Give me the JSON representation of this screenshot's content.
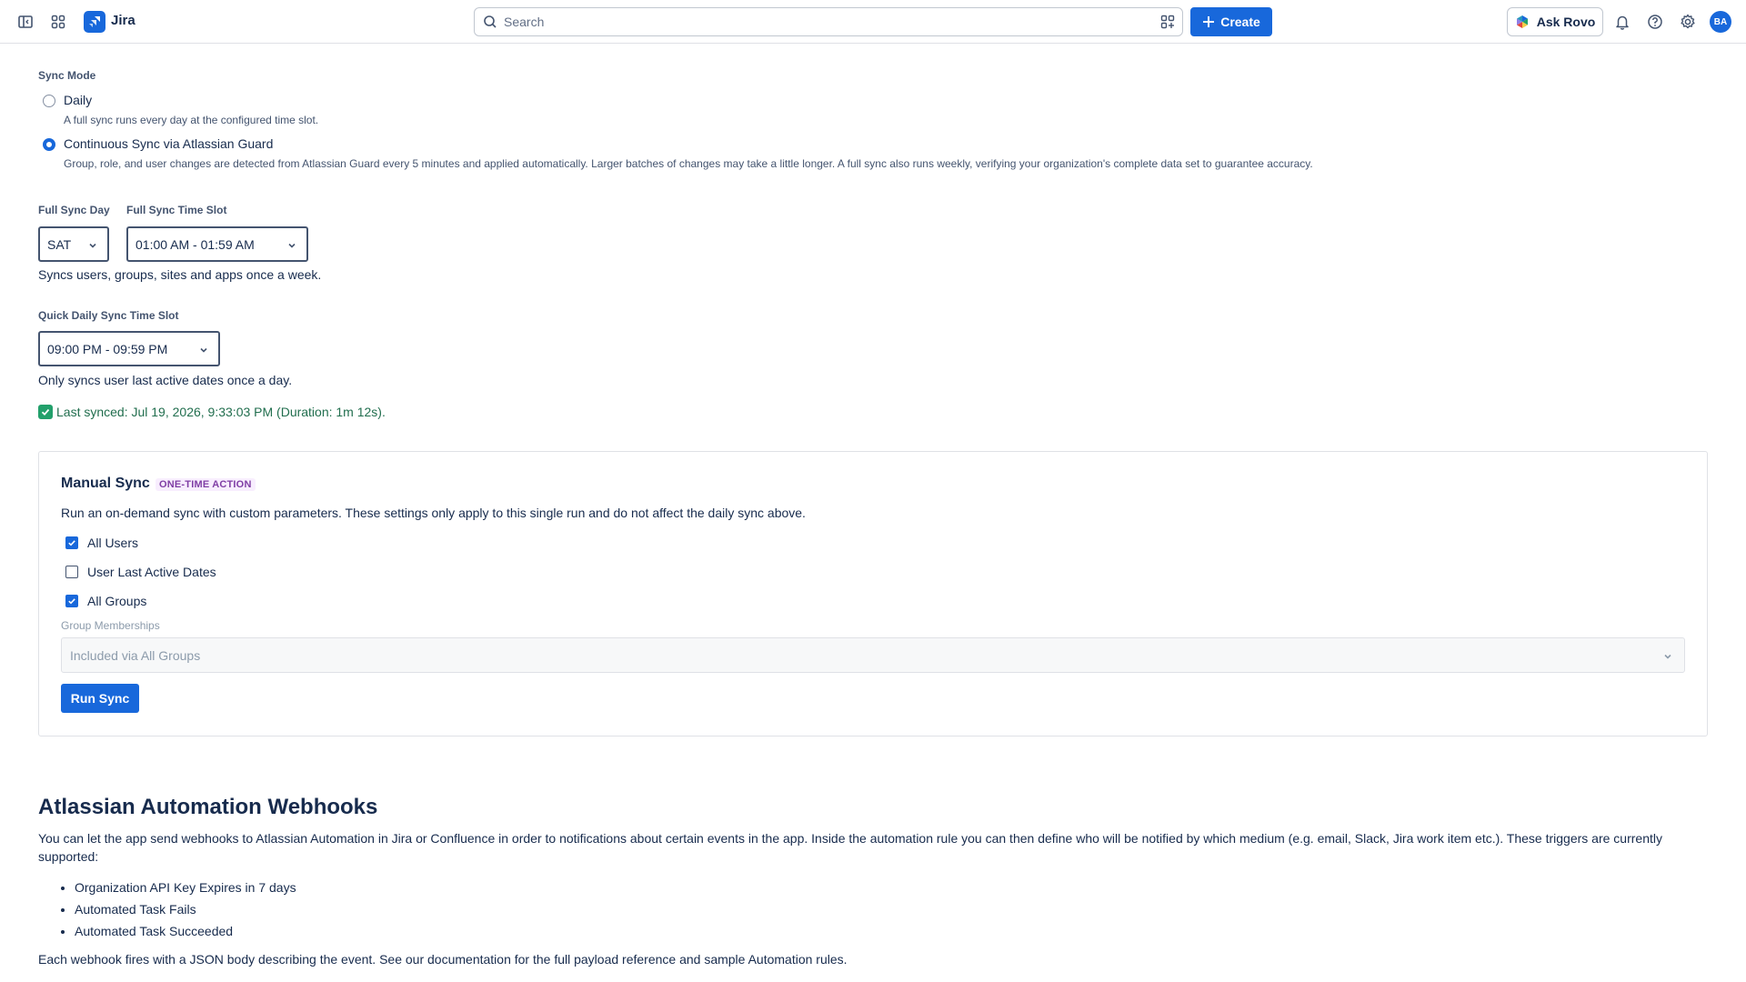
{
  "topbar": {
    "app_name": "Jira",
    "search_placeholder": "Search",
    "create_label": "Create",
    "rovo_label": "Ask Rovo",
    "avatar_initials": "BA",
    "brand_color": "#1868db"
  },
  "sync_mode": {
    "label": "Sync Mode",
    "options": [
      {
        "label": "Daily",
        "description": "A full sync runs every day at the configured time slot.",
        "selected": false
      },
      {
        "label": "Continuous Sync via Atlassian Guard",
        "description": "Group, role, and user changes are detected from Atlassian Guard every 5 minutes and applied automatically. Larger batches of changes may take a little longer. A full sync also runs weekly, verifying your organization's complete data set to guarantee accuracy.",
        "selected": true
      }
    ]
  },
  "full_sync": {
    "day_label": "Full Sync Day",
    "day_value": "SAT",
    "slot_label": "Full Sync Time Slot",
    "slot_value": "01:00 AM - 01:59 AM",
    "helper": "Syncs users, groups, sites and apps once a week."
  },
  "quick_sync": {
    "label": "Quick Daily Sync Time Slot",
    "value": "09:00 PM - 09:59 PM",
    "helper": "Only syncs user last active dates once a day."
  },
  "last_synced": "Last synced: Jul 19, 2026, 9:33:03 PM (Duration: 1m 12s).",
  "manual_sync": {
    "title": "Manual Sync",
    "badge": "ONE-TIME ACTION",
    "description": "Run an on-demand sync with custom parameters. These settings only apply to this single run and do not affect the daily sync above.",
    "options": [
      {
        "label": "All Users",
        "checked": true
      },
      {
        "label": "User Last Active Dates",
        "checked": false
      },
      {
        "label": "All Groups",
        "checked": true
      }
    ],
    "group_memberships_label": "Group Memberships",
    "group_memberships_value": "Included via All Groups",
    "run_label": "Run Sync"
  },
  "webhooks": {
    "title": "Atlassian Automation Webhooks",
    "intro": "You can let the app send webhooks to Atlassian Automation in Jira or Confluence in order to notifications about certain events in the app. Inside the automation rule you can then define who will be notified by which medium (e.g. email, Slack, Jira work item etc.). These triggers are currently supported:",
    "triggers": [
      "Organization API Key Expires in 7 days",
      "Automated Task Fails",
      "Automated Task Succeeded"
    ],
    "footer": "Each webhook fires with a JSON body describing the event. See our documentation for the full payload reference and sample Automation rules."
  }
}
